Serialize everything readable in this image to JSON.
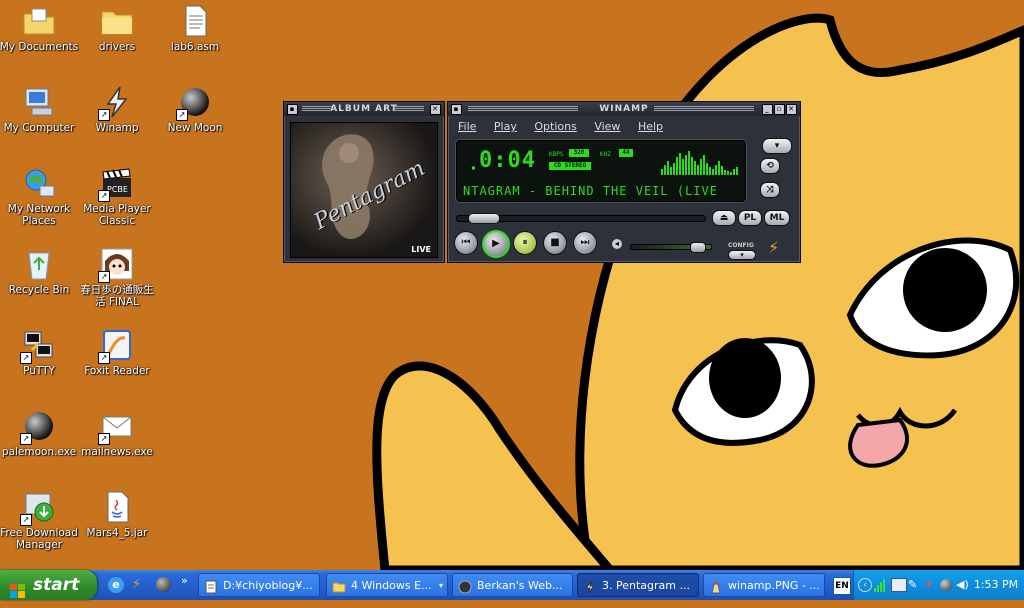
{
  "desktop": {
    "icons": [
      {
        "label": "My Documents",
        "icon": "folder-documents-icon"
      },
      {
        "label": "drivers",
        "icon": "folder-icon"
      },
      {
        "label": "lab6.asm",
        "icon": "text-file-icon"
      },
      {
        "label": "My Computer",
        "icon": "computer-icon"
      },
      {
        "label": "Winamp",
        "icon": "winamp-icon"
      },
      {
        "label": "New Moon",
        "icon": "moon-icon"
      },
      {
        "label": "My Network Places",
        "icon": "network-icon"
      },
      {
        "label": "Media Player Classic",
        "icon": "clapperboard-icon"
      },
      {
        "label": "Recycle Bin",
        "icon": "recycle-bin-icon"
      },
      {
        "label": "春日歩の通販生活 FINAL",
        "icon": "anime-face-icon"
      },
      {
        "label": "PuTTY",
        "icon": "putty-icon"
      },
      {
        "label": "Foxit Reader",
        "icon": "pdf-reader-icon"
      },
      {
        "label": "palemoon.exe",
        "icon": "moon-icon"
      },
      {
        "label": "mailnews.exe",
        "icon": "mail-icon"
      },
      {
        "label": "Free Download Manager",
        "icon": "download-manager-icon"
      },
      {
        "label": "Mars4_5.jar",
        "icon": "java-jar-icon"
      }
    ]
  },
  "album_art": {
    "title": "ALBUM ART",
    "cover_text": "Pentagram",
    "badge": "LIVE"
  },
  "winamp": {
    "title": "WINAMP",
    "menu": [
      "File",
      "Play",
      "Options",
      "View",
      "Help"
    ],
    "time": "0:04",
    "kbps_label": "KBPS",
    "kbps": "320",
    "khz_label": "KHZ",
    "khz": "44",
    "stereo": "CD STEREO",
    "marquee": "NTAGRAM - BEHIND THE VEIL (LIVE",
    "config_label": "CONFIG",
    "pl_label": "PL",
    "ml_label": "ML",
    "seek_fraction": 0.05,
    "volume_fraction": 0.9,
    "colors": {
      "lcd_green": "#2bdc1d",
      "frame": "#2d3139"
    }
  },
  "taskbar": {
    "start_label": "start",
    "tasks": [
      {
        "label": "D:¥chiyoblog¥...",
        "icon": "notepad-icon"
      },
      {
        "label": "4 Windows E...",
        "icon": "folder-icon"
      },
      {
        "label": "Berkan's Web...",
        "icon": "moon-icon"
      },
      {
        "label": "3. Pentagram ...",
        "icon": "winamp-icon"
      },
      {
        "label": "winamp.PNG - ...",
        "icon": "paint-icon"
      }
    ],
    "language": "EN",
    "clock": "1:53 PM"
  }
}
